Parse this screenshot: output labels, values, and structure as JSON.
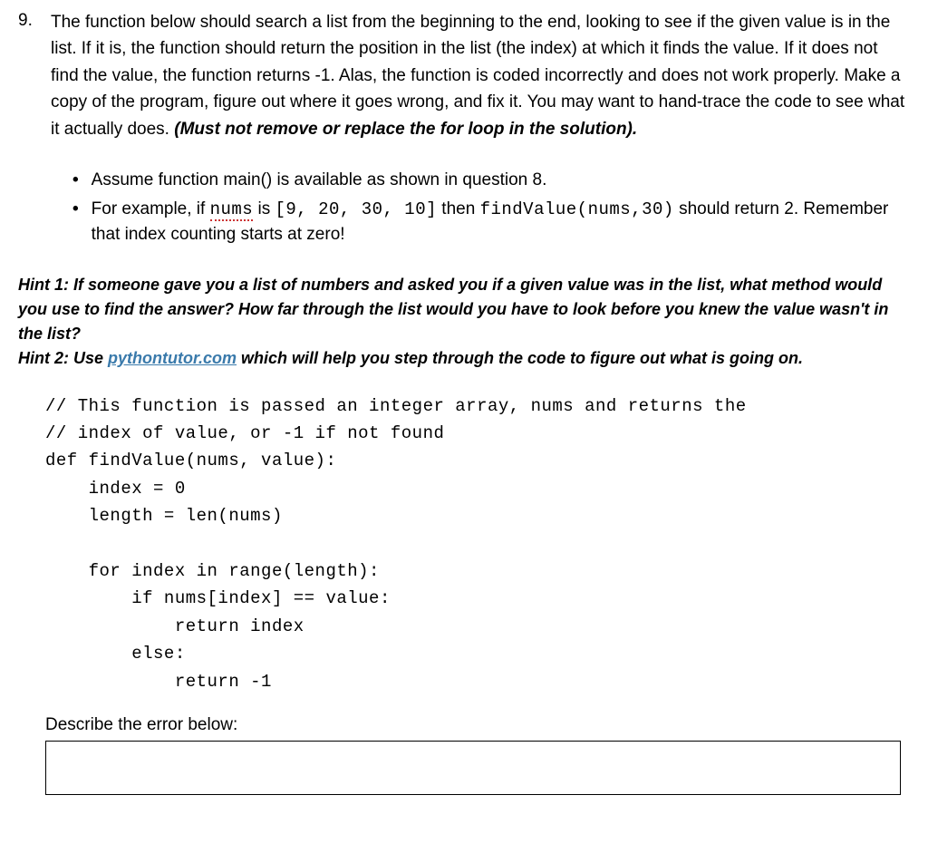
{
  "question": {
    "number": "9.",
    "text_part1": "The function below should search a list from the beginning to the end, looking to see if the given value is in the list. If it is, the function should return the position in the list (the index) at which it finds the value. If it does not find the value, the function returns -1. Alas, the function is coded incorrectly and does not work properly. Make a copy of the program, figure out where it goes wrong, and fix it. You may want to hand-trace the code to see what it actually does. ",
    "text_emphasis": "(Must not remove or replace the for loop in the solution)."
  },
  "bullets": {
    "b1": "Assume function main() is available as shown in question 8.",
    "b2_pre": "For example, if ",
    "b2_nums_word": "nums",
    "b2_mid1": " is ",
    "b2_list": "[9, 20, 30, 10]",
    "b2_mid2": " then ",
    "b2_call": "findValue(nums,30)",
    "b2_post": " should return 2.  Remember that index counting starts at zero!"
  },
  "hints": {
    "h1": "Hint 1: If someone gave you a list of numbers and asked you if a given value was in the list, what method would you use to find the answer? How far through the list would you have to look before you knew the value wasn't in the list?",
    "h2_pre": "Hint 2: Use ",
    "h2_link": "pythontutor.com",
    "h2_post": " which will help you step through the code to figure out what is going on."
  },
  "code": {
    "l1": "// This function is passed an integer array, nums and returns the",
    "l2": "// index of value, or -1 if not found",
    "l3": "def findValue(nums, value):",
    "l4": "    index = 0",
    "l5": "    length = len(nums)",
    "l6": "",
    "l7": "    for index in range(length):",
    "l8": "        if nums[index] == value:",
    "l9": "            return index",
    "l10": "        else:",
    "l11": "            return -1"
  },
  "describe_label": "Describe the error below:"
}
